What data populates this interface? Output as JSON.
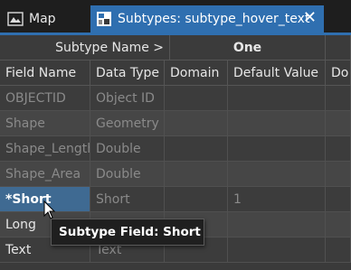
{
  "tabs": [
    {
      "label": "Map",
      "icon": "map-tab-icon",
      "active": false
    },
    {
      "label": "Subtypes: subtype_hover_text",
      "icon": "subtypes-tab-icon",
      "active": true
    }
  ],
  "close_glyph": "✕",
  "grid": {
    "subtype_header_label": "Subtype Name >",
    "subtype_name": "One",
    "columns": [
      "Field Name",
      "Data Type",
      "Domain",
      "Default Value",
      "Do"
    ],
    "rows": [
      {
        "field": "OBJECTID",
        "type": "Object ID",
        "domain": "",
        "default": "",
        "editable": false
      },
      {
        "field": "Shape",
        "type": "Geometry",
        "domain": "",
        "default": "",
        "editable": false
      },
      {
        "field": "Shape_Length",
        "type": "Double",
        "domain": "",
        "default": "",
        "editable": false
      },
      {
        "field": "Shape_Area",
        "type": "Double",
        "domain": "",
        "default": "",
        "editable": false
      },
      {
        "field": "*Short",
        "type": "Short",
        "domain": "",
        "default": "1",
        "editable": true,
        "selected": true
      },
      {
        "field": "Long",
        "type": "",
        "domain": "",
        "default": "",
        "editable": true
      },
      {
        "field": "Text",
        "type": "Text",
        "domain": "",
        "default": "",
        "editable": true
      }
    ]
  },
  "tooltip": "Subtype Field: Short",
  "colors": {
    "accent": "#2f6fb0",
    "selected_cell": "#3f6a92"
  }
}
